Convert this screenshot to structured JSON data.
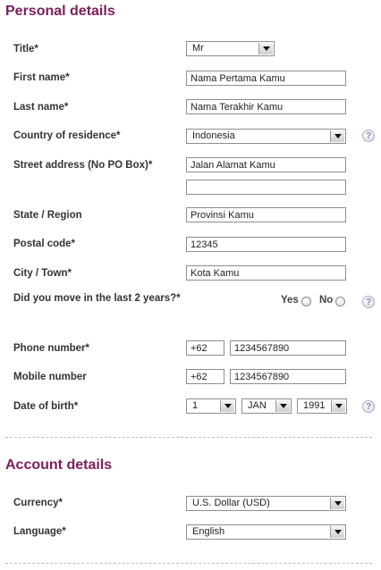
{
  "personal": {
    "heading": "Personal details",
    "title": {
      "label": "Title*",
      "value": "Mr"
    },
    "first_name": {
      "label": "First name*",
      "value": "Nama Pertama Kamu"
    },
    "last_name": {
      "label": "Last name*",
      "value": "Nama Terakhir Kamu"
    },
    "country": {
      "label": "Country of residence*",
      "value": "Indonesia"
    },
    "street": {
      "label": "Street address (No PO Box)*",
      "line1": "Jalan Alamat Kamu",
      "line2": ""
    },
    "state": {
      "label": "State / Region",
      "value": "Provinsi Kamu"
    },
    "postal": {
      "label": "Postal code*",
      "value": "12345"
    },
    "city": {
      "label": "City / Town*",
      "value": "Kota Kamu"
    },
    "moved": {
      "label": "Did you move in the last 2 years?*",
      "yes": "Yes",
      "no": "No"
    },
    "phone": {
      "label": "Phone number*",
      "code": "+62",
      "number": "1234567890"
    },
    "mobile": {
      "label": "Mobile number",
      "code": "+62",
      "number": "1234567890"
    },
    "dob": {
      "label": "Date of birth*",
      "day": "1",
      "month": "JAN",
      "year": "1991"
    },
    "help_glyph": "?"
  },
  "account": {
    "heading": "Account details",
    "currency": {
      "label": "Currency*",
      "value": "U.S. Dollar (USD)"
    },
    "language": {
      "label": "Language*",
      "value": "English"
    }
  },
  "colors": {
    "heading": "#7a1f5c",
    "help_icon": "#7f8aa6"
  },
  "icons": {
    "help": "help-question-icon",
    "dropdown": "chevron-down-icon",
    "radio": "radio-button"
  }
}
